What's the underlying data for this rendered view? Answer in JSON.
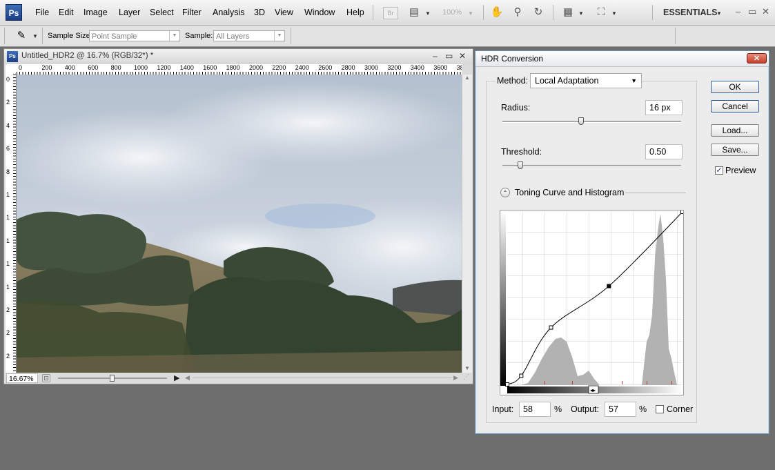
{
  "app": {
    "logo": "Ps",
    "menus": [
      "File",
      "Edit",
      "Image",
      "Layer",
      "Select",
      "Filter",
      "Analysis",
      "3D",
      "View",
      "Window",
      "Help"
    ],
    "zoom_display": "100%",
    "workspace": "ESSENTIALS",
    "window_controls": [
      "–",
      "▭",
      "✕"
    ],
    "icons": [
      "bridge-icon",
      "camera-raw-icon",
      "hand-icon",
      "zoom-icon",
      "rotate-icon",
      "arrange-documents-icon",
      "screen-mode-icon"
    ]
  },
  "options_bar": {
    "tool_icon": "eyedropper-icon",
    "sample_size_label": "Sample Size:",
    "sample_size_value": "Point Sample",
    "sample_label": "Sample:",
    "sample_value": "All Layers"
  },
  "document": {
    "title": "Untitled_HDR2 @ 16.7% (RGB/32*) *",
    "zoom": "16.67%",
    "ruler_ticks": [
      "0",
      "200",
      "400",
      "600",
      "800",
      "1000",
      "1200",
      "1400",
      "1600",
      "1800",
      "2000",
      "2200",
      "2400",
      "2600",
      "2800",
      "3000",
      "3200",
      "3400",
      "3600",
      "38"
    ],
    "vruler_ticks": [
      "0",
      "2",
      "4",
      "6",
      "8",
      "1",
      "1",
      "1",
      "1",
      "1",
      "2",
      "2",
      "2"
    ],
    "window_controls": [
      "–",
      "▭",
      "✕"
    ]
  },
  "dialog": {
    "title": "HDR Conversion",
    "method_label": "Method:",
    "method_value": "Local Adaptation",
    "radius_label": "Radius:",
    "radius_value": "16 px",
    "radius_slider": 0.44,
    "threshold_label": "Threshold:",
    "threshold_value": "0.50",
    "threshold_slider": 0.1,
    "curve_section_label": "Toning Curve and Histogram",
    "input_label": "Input:",
    "input_value": "58",
    "input_unit": "%",
    "output_label": "Output:",
    "output_value": "57",
    "output_unit": "%",
    "corner_label": "Corner",
    "corner_checked": false,
    "ok_label": "OK",
    "cancel_label": "Cancel",
    "load_label": "Load...",
    "save_label": "Save...",
    "preview_label": "Preview",
    "preview_checked": true,
    "check_mark": "✓",
    "curve_points": [
      [
        0,
        0
      ],
      [
        0.08,
        0.05
      ],
      [
        0.25,
        0.33
      ],
      [
        0.58,
        0.57
      ],
      [
        1,
        1
      ]
    ]
  },
  "colors": {
    "accent": "#2b5c97",
    "sky": "#b9c7d6",
    "histogram": "#b2b2b2"
  }
}
